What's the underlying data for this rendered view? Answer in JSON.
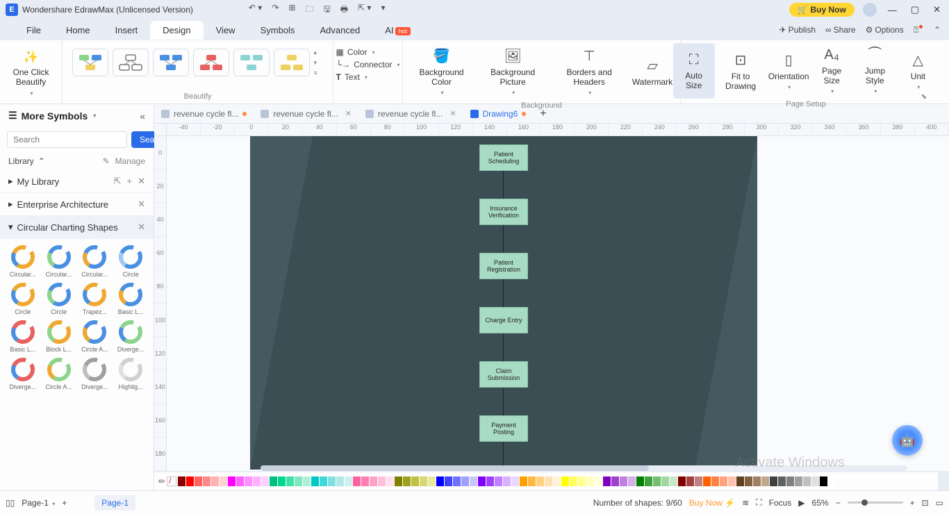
{
  "app": {
    "title": "Wondershare EdrawMax (Unlicensed Version)",
    "buynow": "Buy Now"
  },
  "menu": {
    "file": "File",
    "home": "Home",
    "insert": "Insert",
    "design": "Design",
    "view": "View",
    "symbols": "Symbols",
    "advanced": "Advanced",
    "ai": "AI",
    "hot": "hot"
  },
  "rightlinks": {
    "publish": "Publish",
    "share": "Share",
    "options": "Options"
  },
  "ribbon": {
    "onebeautify": "One Click\nBeautify",
    "beautify_label": "Beautify",
    "color": "Color",
    "connector": "Connector",
    "text": "Text",
    "bgcolor": "Background Color",
    "bgpic": "Background Picture",
    "borders": "Borders and Headers",
    "watermark": "Watermark",
    "bg_label": "Background",
    "autosize": "Auto Size",
    "fit": "Fit to Drawing",
    "orient": "Orientation",
    "pagesize": "Page Size",
    "jump": "Jump Style",
    "unit": "Unit",
    "pagesetup_label": "Page Setup"
  },
  "doctabs": {
    "t1": "revenue cycle fl...",
    "t2": "revenue cycle fl...",
    "t3": "revenue cycle fl...",
    "t4": "Drawing6"
  },
  "sidebar": {
    "moresymbols": "More Symbols",
    "search_placeholder": "Search",
    "search_btn": "Search",
    "library": "Library",
    "manage": "Manage",
    "mylibrary": "My Library",
    "enterprise": "Enterprise Architecture",
    "circular": "Circular Charting Shapes",
    "shapes": [
      "Circular...",
      "Circular...",
      "Circular...",
      "Circle",
      "Circle",
      "Circle",
      "Trapez...",
      "Basic L...",
      "Basic L...",
      "Block L...",
      "Circle A...",
      "Diverge...",
      "Diverge...",
      "Circle A...",
      "Diverge...",
      "Highlig..."
    ]
  },
  "flow": {
    "n1": "Patient Scheduling",
    "n2": "Insurance Verification",
    "n3": "Patient Registration",
    "n4": "Charge Entry",
    "n5": "Claim Submission",
    "n6": "Payment Posting"
  },
  "status": {
    "page": "Page-1",
    "pagetab": "Page-1",
    "shapes": "Number of shapes: 9/60",
    "buynow": "Buy Now",
    "focus": "Focus",
    "zoom": "65%"
  },
  "hruler": [
    "-40",
    "-20",
    "0",
    "20",
    "40",
    "60",
    "80",
    "100",
    "120",
    "140",
    "160",
    "180",
    "200",
    "220",
    "240",
    "260",
    "280",
    "300",
    "320",
    "340",
    "360",
    "380",
    "400"
  ],
  "vruler": [
    "0",
    "20",
    "40",
    "60",
    "80",
    "100",
    "120",
    "140",
    "160",
    "180"
  ],
  "watermark_os": "Activate Windows",
  "colors": [
    "#8b0000",
    "#ff0000",
    "#ff6060",
    "#ff8888",
    "#ffb0b0",
    "#ffd0d0",
    "#ff00ff",
    "#ff60ff",
    "#ff90ff",
    "#ffb0ff",
    "#ffd0ff",
    "#00c080",
    "#00d890",
    "#40e0a8",
    "#80e8c0",
    "#b0f0d8",
    "#00c8c8",
    "#40d8d8",
    "#80e0e0",
    "#b0e8e8",
    "#d0f0f0",
    "#ff60a0",
    "#ff80b0",
    "#ffa0c8",
    "#ffc0d8",
    "#ffe0ec",
    "#808000",
    "#a0a020",
    "#c0c040",
    "#d8d870",
    "#e8e8a0",
    "#0000ff",
    "#4040ff",
    "#7070ff",
    "#a0a0ff",
    "#c8c8ff",
    "#8000ff",
    "#a040ff",
    "#c080ff",
    "#d8b0ff",
    "#e8d8ff",
    "#ffa000",
    "#ffb840",
    "#ffd080",
    "#ffe0b0",
    "#fff0d8",
    "#ffff00",
    "#ffff60",
    "#ffff90",
    "#ffffc0",
    "#ffffe0",
    "#8000c0",
    "#a040d0",
    "#c080e0",
    "#d8b0e8",
    "#008000",
    "#40a040",
    "#70c070",
    "#a0d8a0",
    "#c8e8c8",
    "#800000",
    "#a04040",
    "#c08080",
    "#ff6000",
    "#ff8040",
    "#ffa080",
    "#ffc0b0",
    "#604020",
    "#806040",
    "#a08060",
    "#c0a890",
    "#404040",
    "#606060",
    "#808080",
    "#a0a0a0",
    "#c0c0c0",
    "#e0e0e0",
    "#000000",
    "#ffffff"
  ]
}
